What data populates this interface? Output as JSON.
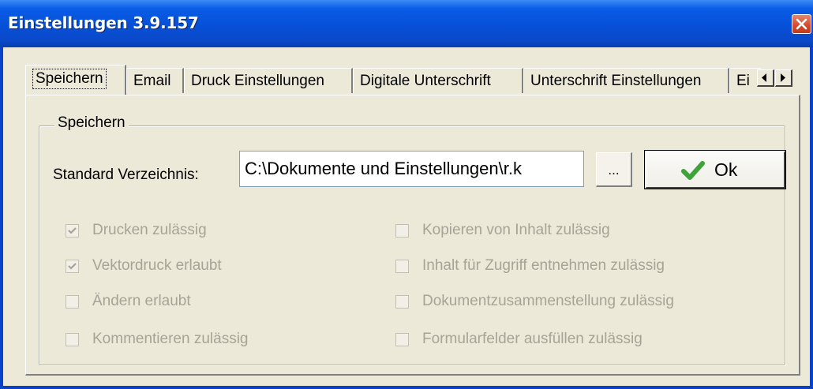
{
  "window": {
    "title": "Einstellungen 3.9.157"
  },
  "tabs": [
    {
      "label": "Speichern",
      "active": true
    },
    {
      "label": "Email",
      "active": false
    },
    {
      "label": "Druck Einstellungen",
      "active": false
    },
    {
      "label": "Digitale Unterschrift",
      "active": false
    },
    {
      "label": "Unterschrift Einstellungen",
      "active": false
    },
    {
      "label": "Ei",
      "active": false
    }
  ],
  "group": {
    "title": "Speichern",
    "directory_label": "Standard Verzeichnis:",
    "directory_value": "C:\\Dokumente und Einstellungen\\r.k",
    "browse_label": "...",
    "ok_label": "Ok"
  },
  "permissions_left": [
    {
      "label": "Drucken zulässig",
      "checked": true
    },
    {
      "label": "Vektordruck erlaubt",
      "checked": true
    },
    {
      "label": "Ändern erlaubt",
      "checked": false
    },
    {
      "label": "Kommentieren zulässig",
      "checked": false
    }
  ],
  "permissions_right": [
    {
      "label": "Kopieren von Inhalt zulässig",
      "checked": false
    },
    {
      "label": "Inhalt für Zugriff entnehmen zulässig",
      "checked": false
    },
    {
      "label": "Dokumentzusammenstellung zulässig",
      "checked": false
    },
    {
      "label": "Formularfelder ausfüllen zulässig",
      "checked": false
    }
  ],
  "colors": {
    "titlebar": "#0650d8",
    "disabled_text": "#a6a397",
    "ok_check": "#3fa33a"
  }
}
